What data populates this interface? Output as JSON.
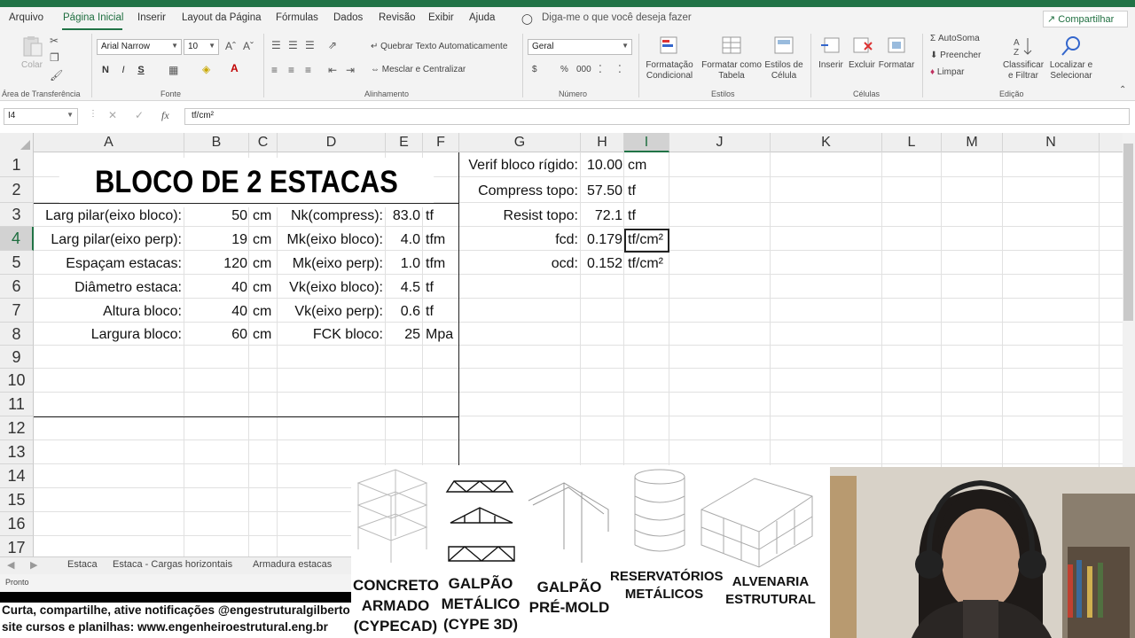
{
  "ribbon_tabs": [
    "Arquivo",
    "Página Inicial",
    "Inserir",
    "Layout da Página",
    "Fórmulas",
    "Dados",
    "Revisão",
    "Exibir",
    "Ajuda"
  ],
  "tell_me": "Diga-me o que você deseja fazer",
  "share": "Compartilhar",
  "clipboard": {
    "paste": "Colar",
    "label": "Área de Transferência"
  },
  "font": {
    "name": "Arial Narrow",
    "size": "10",
    "bold": "N",
    "italic": "I",
    "underline": "S",
    "label": "Fonte"
  },
  "alignment": {
    "wrap": "Quebrar Texto Automaticamente",
    "merge": "Mesclar e Centralizar",
    "label": "Alinhamento"
  },
  "number": {
    "format": "Geral",
    "currency": "$",
    "percent": "%",
    "thousands": "000",
    "label": "Número"
  },
  "styles": {
    "conditional": [
      "Formatação",
      "Condicional"
    ],
    "table": [
      "Formatar como",
      "Tabela"
    ],
    "cell_styles": [
      "Estilos de",
      "Célula"
    ],
    "label": "Estilos"
  },
  "cells": {
    "insert": "Inserir",
    "delete": "Excluir",
    "format": "Formatar",
    "label": "Células"
  },
  "editing": {
    "autosum": "AutoSoma",
    "fill": "Preencher",
    "clear": "Limpar",
    "sort": [
      "Classificar",
      "e Filtrar"
    ],
    "find": [
      "Localizar e",
      "Selecionar"
    ],
    "label": "Edição"
  },
  "namebox": "I4",
  "formula": "tf/cm²",
  "columns": [
    "A",
    "B",
    "C",
    "D",
    "E",
    "F",
    "G",
    "H",
    "I",
    "J",
    "K",
    "L",
    "M",
    "N"
  ],
  "rows": [
    "1",
    "2",
    "3",
    "4",
    "5",
    "6",
    "7",
    "8",
    "9",
    "10",
    "11",
    "12",
    "13",
    "14",
    "15",
    "16",
    "17"
  ],
  "title": "BLOCO DE 2 ESTACAS",
  "table_rows": [
    {
      "label": "Larg pilar(eixo bloco):",
      "value": "50",
      "unit": "cm",
      "label2": "Nk(compress):",
      "value2": "83.0",
      "unit2": "tf"
    },
    {
      "label": "Larg pilar(eixo perp):",
      "value": "19",
      "unit": "cm",
      "label2": "Mk(eixo bloco):",
      "value2": "4.0",
      "unit2": "tfm"
    },
    {
      "label": "Espaçam estacas:",
      "value": "120",
      "unit": "cm",
      "label2": "Mk(eixo perp):",
      "value2": "1.0",
      "unit2": "tfm"
    },
    {
      "label": "Diâmetro estaca:",
      "value": "40",
      "unit": "cm",
      "label2": "Vk(eixo bloco):",
      "value2": "4.5",
      "unit2": "tf"
    },
    {
      "label": "Altura bloco:",
      "value": "40",
      "unit": "cm",
      "label2": "Vk(eixo perp):",
      "value2": "0.6",
      "unit2": "tf"
    },
    {
      "label": "Largura bloco:",
      "value": "60",
      "unit": "cm",
      "label2": "FCK bloco:",
      "value2": "25",
      "unit2": "Mpa"
    }
  ],
  "results": [
    {
      "label": "Verif bloco rígido:",
      "value": "10.00",
      "unit": "cm"
    },
    {
      "label": "Compress topo:",
      "value": "57.50",
      "unit": "tf"
    },
    {
      "label": "Resist topo:",
      "value": "72.1",
      "unit": "tf"
    },
    {
      "label": "fcd:",
      "value": "0.179",
      "unit": "tf/cm²"
    },
    {
      "label": "ocd:",
      "value": "0.152",
      "unit": "tf/cm²"
    }
  ],
  "sheet_tabs": [
    "Estaca",
    "Estaca - Cargas horizontais",
    "Armadura estacas"
  ],
  "status": "Pronto",
  "promo": {
    "items": [
      [
        "CONCRETO",
        "ARMADO",
        "(CYPECAD)"
      ],
      [
        "GALPÃO",
        "METÁLICO",
        "(CYPE 3D)"
      ],
      [
        "GALPÃO",
        "PRÉ-MOLD"
      ],
      [
        "RESERVATÓRIOS",
        "METÁLICOS"
      ],
      [
        "ALVENARIA",
        "ESTRUTURAL"
      ]
    ]
  },
  "banner": {
    "line1": "Curta, compartilhe, ative notificações @engestruturalgilberto",
    "line2": "site cursos e planilhas: www.engenheiroestrutural.eng.br"
  },
  "colors": {
    "excel_green": "#217346",
    "ribbon_bg": "#f3f3f3",
    "gridline": "#e1e1e1"
  }
}
